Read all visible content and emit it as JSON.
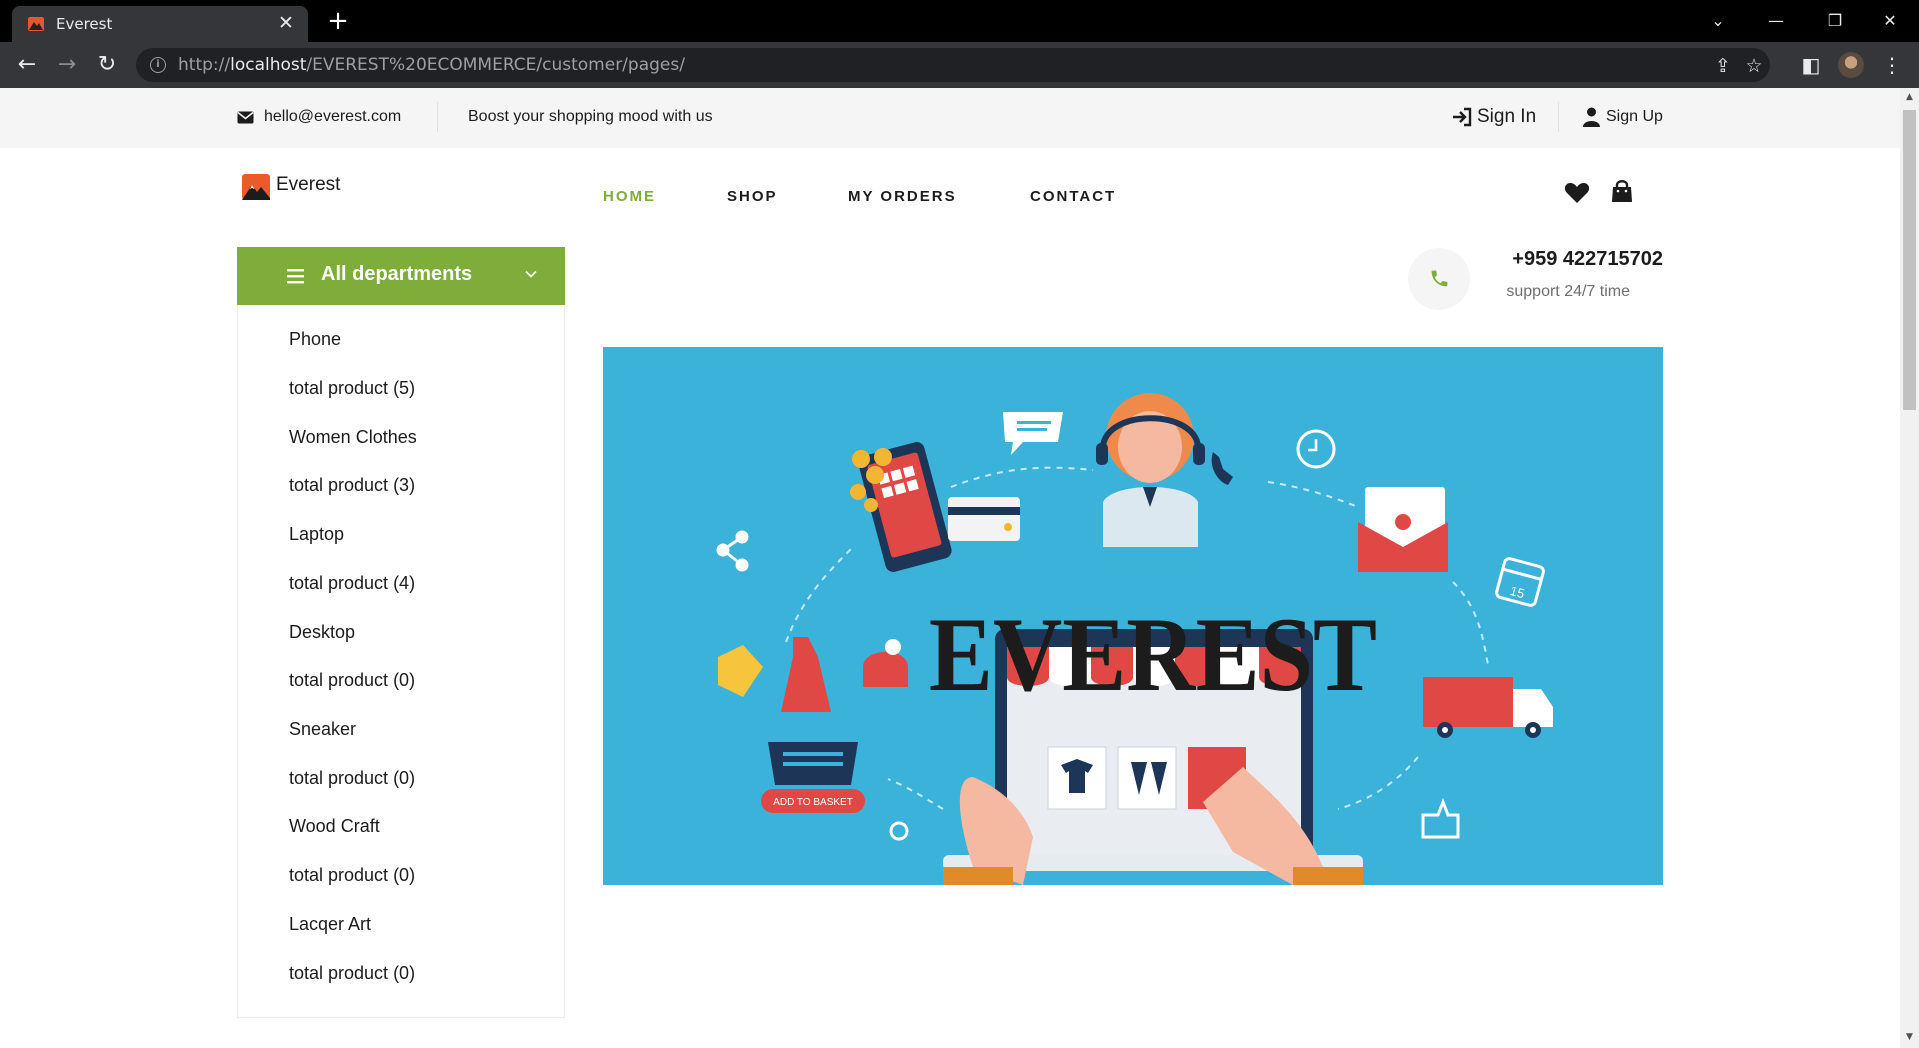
{
  "browser": {
    "tab_title": "Everest",
    "url_prefix": "http://",
    "url_host": "localhost",
    "url_path": "/EVEREST%20ECOMMERCE/customer/pages/",
    "icons": [
      "back-icon",
      "forward-icon",
      "reload-icon",
      "share-icon",
      "star-icon",
      "sidepanel-icon",
      "profile-avatar",
      "menu-icon"
    ]
  },
  "topbar": {
    "email": "hello@everest.com",
    "tagline": "Boost your shopping mood with us",
    "sign_in": "Sign In",
    "sign_up": "Sign Up"
  },
  "brand": {
    "name": "Everest"
  },
  "nav": [
    {
      "label": "HOME",
      "active": true
    },
    {
      "label": "SHOP",
      "active": false
    },
    {
      "label": "MY ORDERS",
      "active": false
    },
    {
      "label": "CONTACT",
      "active": false
    }
  ],
  "sidebar": {
    "title": "All departments",
    "items": [
      "Phone",
      "total product (5)",
      "Women Clothes",
      "total product (3)",
      "Laptop",
      "total product (4)",
      "Desktop",
      "total product (0)",
      "Sneaker",
      "total product (0)",
      "Wood Craft",
      "total product (0)",
      "Lacqer Art",
      "total product (0)"
    ]
  },
  "support": {
    "phone": "+959 422715702",
    "note": "support 24/7 time"
  },
  "hero": {
    "banner_text": "EVEREST",
    "basket_label": "ADD TO BASKET",
    "calendar_day": "15"
  },
  "colors": {
    "accent": "#7fad39",
    "hero_bg": "#3bb2d9",
    "awning_red": "#e04846",
    "dark_navy": "#1d3557"
  }
}
